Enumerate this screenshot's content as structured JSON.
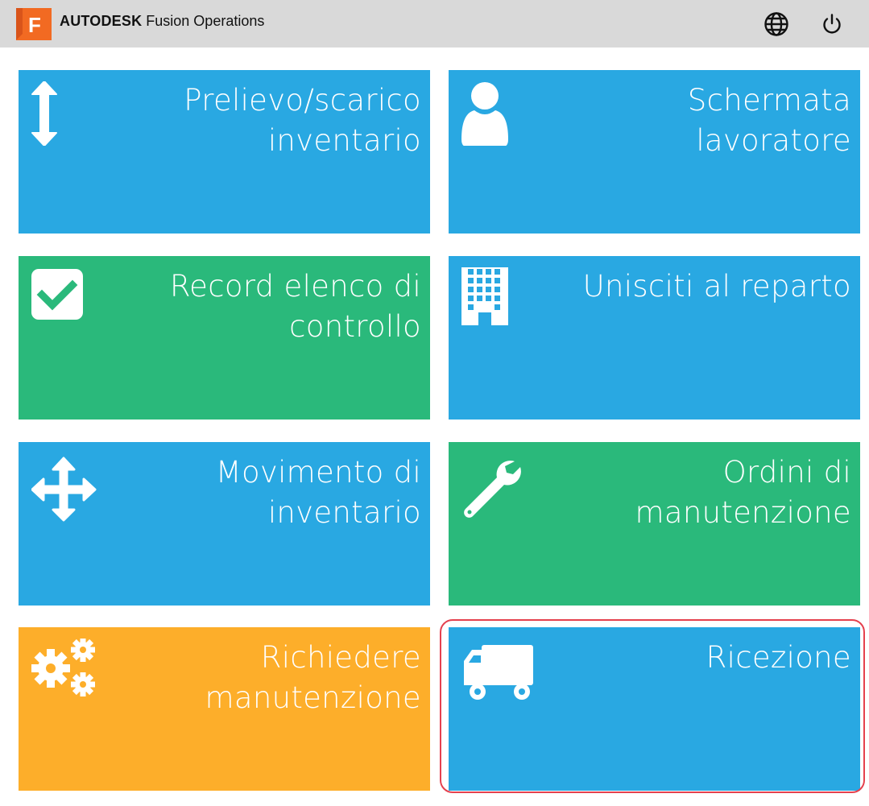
{
  "header": {
    "logo_letter": "F",
    "brand_bold": "AUTODESK",
    "brand_name": "Fusion Operations",
    "icons": [
      "globe-icon",
      "power-icon"
    ]
  },
  "tiles": [
    {
      "label": "Prelievo/scarico inventario",
      "color": "#29a8e2",
      "icon": "vertical-arrows-icon"
    },
    {
      "label": "Schermata lavoratore",
      "color": "#29a8e2",
      "icon": "user-icon"
    },
    {
      "label": "Record elenco di controllo",
      "color": "#2ab97b",
      "icon": "checkbox-icon"
    },
    {
      "label": "Unisciti al reparto",
      "color": "#29a8e2",
      "icon": "building-icon"
    },
    {
      "label": "Movimento di inventario",
      "color": "#29a8e2",
      "icon": "move-arrows-icon"
    },
    {
      "label": "Ordini di manutenzione",
      "color": "#2ab97b",
      "icon": "wrench-icon"
    },
    {
      "label": "Richiedere manutenzione",
      "color": "#fdae2a",
      "icon": "gears-icon"
    },
    {
      "label": "Ricezione",
      "color": "#29a8e2",
      "icon": "truck-icon",
      "highlighted": true
    }
  ],
  "colors": {
    "header_bg": "#d9d9d9",
    "logo": "#f26a22",
    "highlight": "#e5414e"
  }
}
